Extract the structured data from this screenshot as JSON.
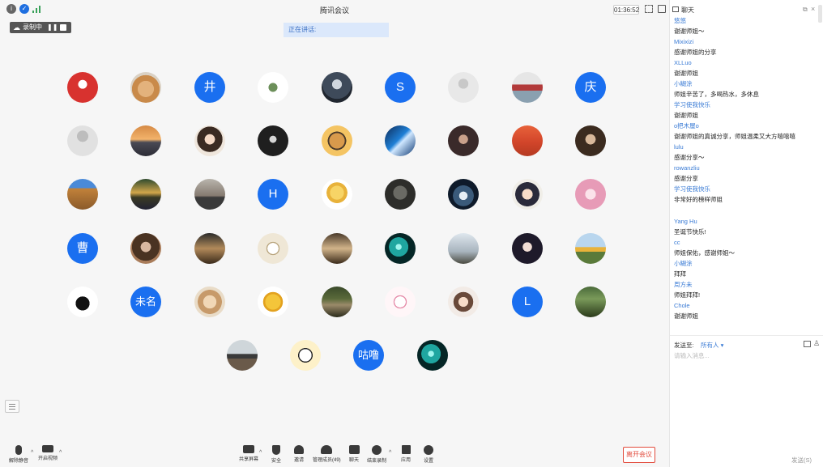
{
  "topbar": {
    "title": "腾讯会议",
    "timer": "01:36:52"
  },
  "recording": {
    "label": "录制中",
    "pause": "❚❚"
  },
  "speaking_banner": "正在讲话:",
  "avatars": [
    {
      "id": "r1c1",
      "style": "java"
    },
    {
      "id": "r1c2",
      "style": "dog"
    },
    {
      "id": "r1c3",
      "style": "letter",
      "text": "井"
    },
    {
      "id": "r1c4",
      "style": "statue"
    },
    {
      "id": "r1c5",
      "style": "robot"
    },
    {
      "id": "r1c6",
      "style": "letter",
      "text": "S"
    },
    {
      "id": "r1c7",
      "style": "default-grey"
    },
    {
      "id": "r1c8",
      "style": "car"
    },
    {
      "id": "r1c9",
      "style": "letter",
      "text": "庆"
    },
    {
      "id": "r2c1",
      "style": "default-person"
    },
    {
      "id": "r2c2",
      "style": "sunset"
    },
    {
      "id": "r2c3",
      "style": "girl-sketch"
    },
    {
      "id": "r2c4",
      "style": "dark-figure"
    },
    {
      "id": "r2c5",
      "style": "cartoon-bear"
    },
    {
      "id": "r2c6",
      "style": "wave"
    },
    {
      "id": "r2c7",
      "style": "portrait-dark"
    },
    {
      "id": "r2c8",
      "style": "desert"
    },
    {
      "id": "r2c9",
      "style": "portrait-male"
    },
    {
      "id": "r3c1",
      "style": "ruins"
    },
    {
      "id": "r3c2",
      "style": "lake"
    },
    {
      "id": "r3c3",
      "style": "horizon"
    },
    {
      "id": "r3c4",
      "style": "letter",
      "text": "H"
    },
    {
      "id": "r3c5",
      "style": "flowers"
    },
    {
      "id": "r3c6",
      "style": "tree"
    },
    {
      "id": "r3c7",
      "style": "astronaut"
    },
    {
      "id": "r3c8",
      "style": "anime-girl"
    },
    {
      "id": "r3c9",
      "style": "pink-anime"
    },
    {
      "id": "r4c1",
      "style": "letter",
      "text": "曹"
    },
    {
      "id": "r4c2",
      "style": "woman"
    },
    {
      "id": "r4c3",
      "style": "cafe"
    },
    {
      "id": "r4c4",
      "style": "sketch-box"
    },
    {
      "id": "r4c5",
      "style": "room"
    },
    {
      "id": "r4c6",
      "style": "teal-glow"
    },
    {
      "id": "r4c7",
      "style": "sky-person"
    },
    {
      "id": "r4c8",
      "style": "woman-dark"
    },
    {
      "id": "r4c9",
      "style": "sunflower"
    },
    {
      "id": "r5c1",
      "style": "silhouette"
    },
    {
      "id": "r5c2",
      "style": "letter",
      "text": "未名"
    },
    {
      "id": "r5c3",
      "style": "bear-plush"
    },
    {
      "id": "r5c4",
      "style": "yellow-cow"
    },
    {
      "id": "r5c5",
      "style": "group-photo"
    },
    {
      "id": "r5c6",
      "style": "decor"
    },
    {
      "id": "r5c7",
      "style": "anime-boy"
    },
    {
      "id": "r5c8",
      "style": "letter",
      "text": "L"
    },
    {
      "id": "r5c9",
      "style": "forest"
    },
    {
      "id": "r6c1",
      "style": "cheer"
    },
    {
      "id": "r6c2",
      "style": "panda-meme"
    },
    {
      "id": "r6c3",
      "style": "letter",
      "text": "咕噜"
    },
    {
      "id": "r6c4",
      "style": "teal-glow"
    }
  ],
  "toolbar": {
    "mute": "解除静音",
    "video": "开启视频",
    "share": "共享屏幕",
    "security": "安全",
    "invite": "邀请",
    "members": "管理成员(49)",
    "chat": "聊天",
    "record": "结束录制",
    "apps": "应用",
    "settings": "设置",
    "end": "离开会议"
  },
  "chat": {
    "title": "聊天",
    "messages": [
      {
        "name": "悠悠",
        "text": "谢谢师姐～"
      },
      {
        "name": "Mixixizi",
        "text": "感谢师姐的分享"
      },
      {
        "name": "XLLuo",
        "text": "谢谢师姐"
      },
      {
        "name": "小糊涂",
        "text": "师姐辛苦了，多喝热水，多休息"
      },
      {
        "name": "学习使我快乐",
        "text": "谢谢师姐"
      },
      {
        "name": "o把木屋o",
        "text": "谢谢师姐的真诚分享，师姐温柔又大方嘻嘻嘻"
      },
      {
        "name": "lulu",
        "text": "感谢分享～"
      },
      {
        "name": "rowanzliu",
        "text": "感谢分享"
      },
      {
        "name": "学习使我快乐",
        "text": "非常好的榜样师姐"
      },
      {
        "name": "Yang Hu",
        "text": "圣诞节快乐!"
      },
      {
        "name": "cc",
        "text": "师姐保佑，感谢师姐～"
      },
      {
        "name": "小糊涂",
        "text": "拜拜"
      },
      {
        "name": "周方未",
        "text": "师姐拜拜!"
      },
      {
        "name": "Chole",
        "text": "谢谢师姐"
      }
    ],
    "send_to_label": "发送至:",
    "send_to_value": "所有人 ▾",
    "input_placeholder": "请输入消息...",
    "send": "发送(S)"
  }
}
